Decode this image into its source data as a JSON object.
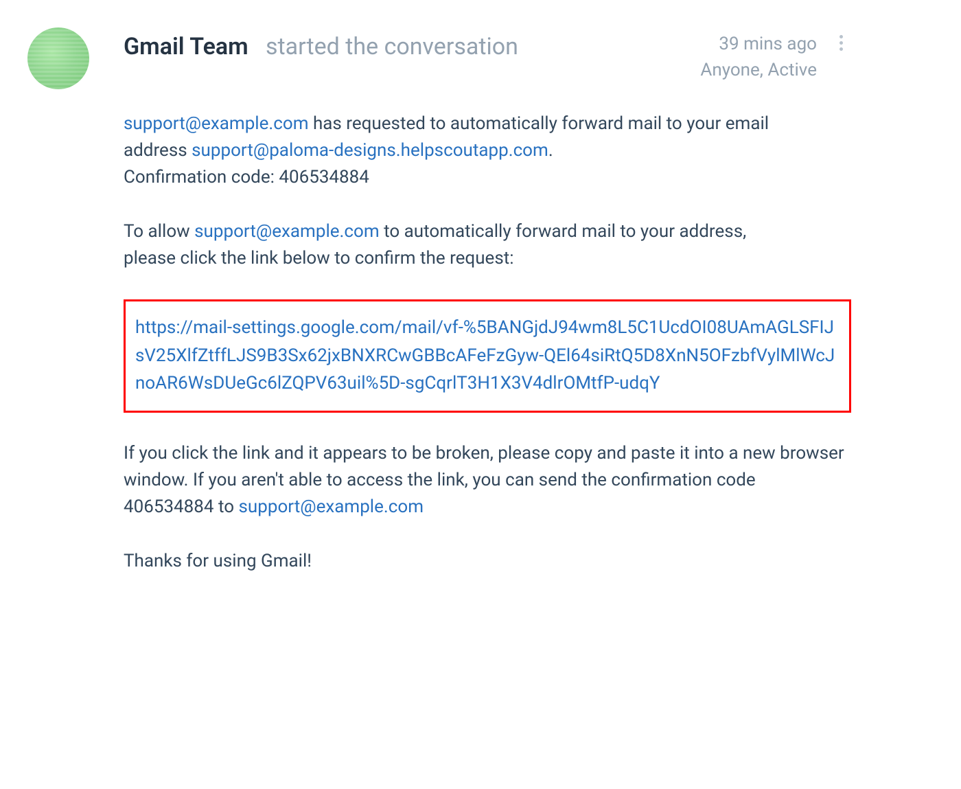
{
  "header": {
    "sender": "Gmail Team",
    "action": "started the conversation",
    "timestamp": "39 mins ago",
    "status": "Anyone, Active"
  },
  "body": {
    "requester_email": "support@example.com",
    "line1_before": "",
    "line1_after": " has requested to automatically forward mail to your email",
    "line2_address_label": "address ",
    "forward_to_email": "support@paloma-designs.helpscoutapp.com",
    "line2_period": ".",
    "confirmation_label": "Confirmation code: ",
    "confirmation_code": "406534884",
    "allow_before": "To allow ",
    "allow_email": "support@example.com",
    "allow_after": " to automatically forward mail to your address,",
    "please_click": "please click the link below to confirm the request:",
    "confirm_link": "https://mail-settings.google.com/mail/vf-%5BANGjdJ94wm8L5C1UcdOI08UAmAGLSFIJsV25XlfZtffLJS9B3Sx62jxBNXRCwGBBcAFeFzGyw-QEl64siRtQ5D8XnN5OFzbfVylMlWcJnoAR6WsDUeGc6lZQPV63uil%5D-sgCqrlT3H1X3V4dlrOMtfP-udqY",
    "fallback_text_1": "If you click the link and it appears to be broken, please copy and paste it into a new browser window. If you aren't able to access the link, you can send the confirmation code",
    "fallback_code": "406534884",
    "fallback_to_word": " to ",
    "fallback_email": "support@example.com",
    "thanks": "Thanks for using Gmail!"
  }
}
